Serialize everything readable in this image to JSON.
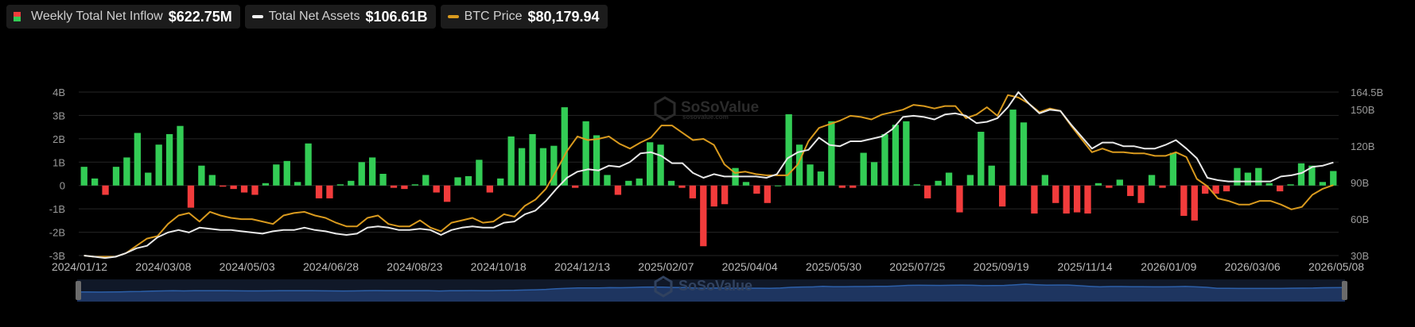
{
  "legend": {
    "inflow": {
      "label": "Weekly Total Net Inflow",
      "value": "$622.75M"
    },
    "assets": {
      "label": "Total Net Assets",
      "value": "$106.61B"
    },
    "btc": {
      "label": "BTC Price",
      "value": "$80,179.94"
    }
  },
  "watermark": {
    "name": "SoSoValue",
    "domain": "sosovalue.com"
  },
  "colors": {
    "positive": "#33cc55",
    "negative": "#f23c3c",
    "assets_line": "#e8e8e8",
    "btc_line": "#d99a1e",
    "grid": "#262626",
    "navigator_fill": "#1e3560",
    "navigator_line": "#2c5fa8",
    "handle": "#6b6b6b"
  },
  "chart_data": {
    "type": "bar",
    "grid": true,
    "legend_position": "top-left",
    "ylim_left": [
      -3,
      4
    ],
    "ylim_right": [
      30,
      164.5
    ],
    "y_left_ticks": [
      "4B",
      "3B",
      "2B",
      "1B",
      "0",
      "-1B",
      "-2B",
      "-3B"
    ],
    "y_right_ticks": [
      "164.5B",
      "150B",
      "120B",
      "90B",
      "60B",
      "30B"
    ],
    "y_right_tick_values": [
      164.5,
      150,
      120,
      90,
      60,
      30
    ],
    "x_ticks": [
      "2024/01/12",
      "2024/03/08",
      "2024/05/03",
      "2024/06/28",
      "2024/08/23",
      "2024/10/18",
      "2024/12/13",
      "2025/02/07",
      "2025/04/04",
      "2025/05/30",
      "2025/07/25",
      "2025/09/19",
      "2025/11/14",
      "2026/01/09",
      "2026/03/06",
      "2026/05/08"
    ],
    "series": [
      {
        "name": "Weekly Total Net Inflow",
        "kind": "bar",
        "unit": "B USD",
        "values": [
          0.8,
          0.3,
          -0.4,
          0.8,
          1.2,
          2.25,
          0.55,
          1.75,
          2.2,
          2.55,
          -0.95,
          0.85,
          0.45,
          -0.05,
          -0.15,
          -0.3,
          -0.4,
          0.1,
          0.9,
          1.05,
          0.15,
          1.8,
          -0.55,
          -0.55,
          0.05,
          0.2,
          1.0,
          1.2,
          0.5,
          -0.1,
          -0.15,
          0.05,
          0.45,
          -0.3,
          -0.7,
          0.35,
          0.4,
          1.1,
          -0.3,
          0.3,
          2.1,
          1.6,
          2.2,
          1.6,
          1.7,
          3.35,
          -0.1,
          2.75,
          2.15,
          0.45,
          -0.4,
          0.2,
          0.3,
          1.85,
          1.75,
          0.2,
          -0.1,
          -0.55,
          -2.6,
          -0.9,
          -0.8,
          0.75,
          0.15,
          -0.35,
          -0.75,
          0.0,
          3.05,
          1.75,
          0.9,
          0.6,
          2.75,
          -0.1,
          -0.1,
          1.4,
          1.0,
          2.2,
          2.6,
          2.75,
          0.05,
          -0.55,
          0.2,
          0.55,
          -1.15,
          0.45,
          2.3,
          0.85,
          -0.9,
          3.25,
          2.7,
          -1.2,
          0.45,
          -0.75,
          -1.2,
          -1.15,
          -1.2,
          0.1,
          -0.1,
          0.25,
          -0.45,
          -0.75,
          0.45,
          -0.1,
          1.4,
          -1.3,
          -1.5,
          -0.35,
          -0.35,
          -0.25,
          0.75,
          0.55,
          0.75,
          0.1,
          -0.25,
          0.05,
          0.95,
          0.85,
          0.15,
          0.62
        ]
      },
      {
        "name": "Total Net Assets",
        "kind": "line",
        "unit": "B USD",
        "values": [
          30,
          29,
          28,
          29,
          32,
          36,
          38,
          45,
          49,
          51,
          49,
          53,
          52,
          51,
          51,
          50,
          49,
          48,
          50,
          51,
          51,
          53,
          51,
          50,
          48,
          47,
          48,
          53,
          54,
          53,
          51,
          51,
          52,
          51,
          47,
          51,
          53,
          54,
          53,
          53,
          57,
          58,
          64,
          67,
          75,
          85,
          94,
          99,
          101,
          100,
          104,
          103,
          107,
          114,
          115,
          112,
          106,
          106,
          98,
          94,
          97,
          95,
          95,
          95,
          95,
          94,
          97,
          110,
          115,
          117,
          127,
          121,
          120,
          124,
          124,
          126,
          128,
          134,
          144,
          145,
          144,
          142,
          146,
          147,
          145,
          139,
          140,
          143,
          152,
          164.5,
          155,
          147,
          150,
          149,
          138,
          128,
          118,
          123,
          123,
          120,
          120,
          118,
          118,
          121,
          125,
          118,
          110,
          94,
          92,
          91,
          91,
          91,
          91,
          91,
          95,
          96,
          98,
          103,
          104,
          106.61
        ]
      },
      {
        "name": "BTC Price",
        "kind": "line",
        "unit": "scaled",
        "values": [
          30,
          29,
          29,
          29,
          32,
          38,
          44,
          46,
          56,
          63,
          65,
          58,
          66,
          63,
          61,
          60,
          60,
          58,
          56,
          63,
          65,
          66,
          63,
          61,
          57,
          54,
          54,
          61,
          63,
          56,
          54,
          54,
          59,
          53,
          50,
          57,
          59,
          61,
          57,
          58,
          64,
          62,
          71,
          76,
          85,
          100,
          116,
          128,
          125,
          126,
          128,
          122,
          118,
          123,
          127,
          137,
          137,
          131,
          125,
          126,
          121,
          105,
          98,
          99,
          97,
          96,
          96,
          96,
          105,
          124,
          135,
          138,
          141,
          145,
          144,
          142,
          146,
          148,
          150,
          154,
          153,
          151,
          153,
          153,
          143,
          146,
          152,
          145,
          162,
          160,
          155,
          148,
          151,
          149,
          137,
          126,
          115,
          118,
          115,
          115,
          114,
          114,
          112,
          112,
          115,
          111,
          93,
          87,
          77,
          75,
          72,
          72,
          75,
          75,
          72,
          68,
          70,
          80,
          85,
          88
        ]
      }
    ]
  }
}
